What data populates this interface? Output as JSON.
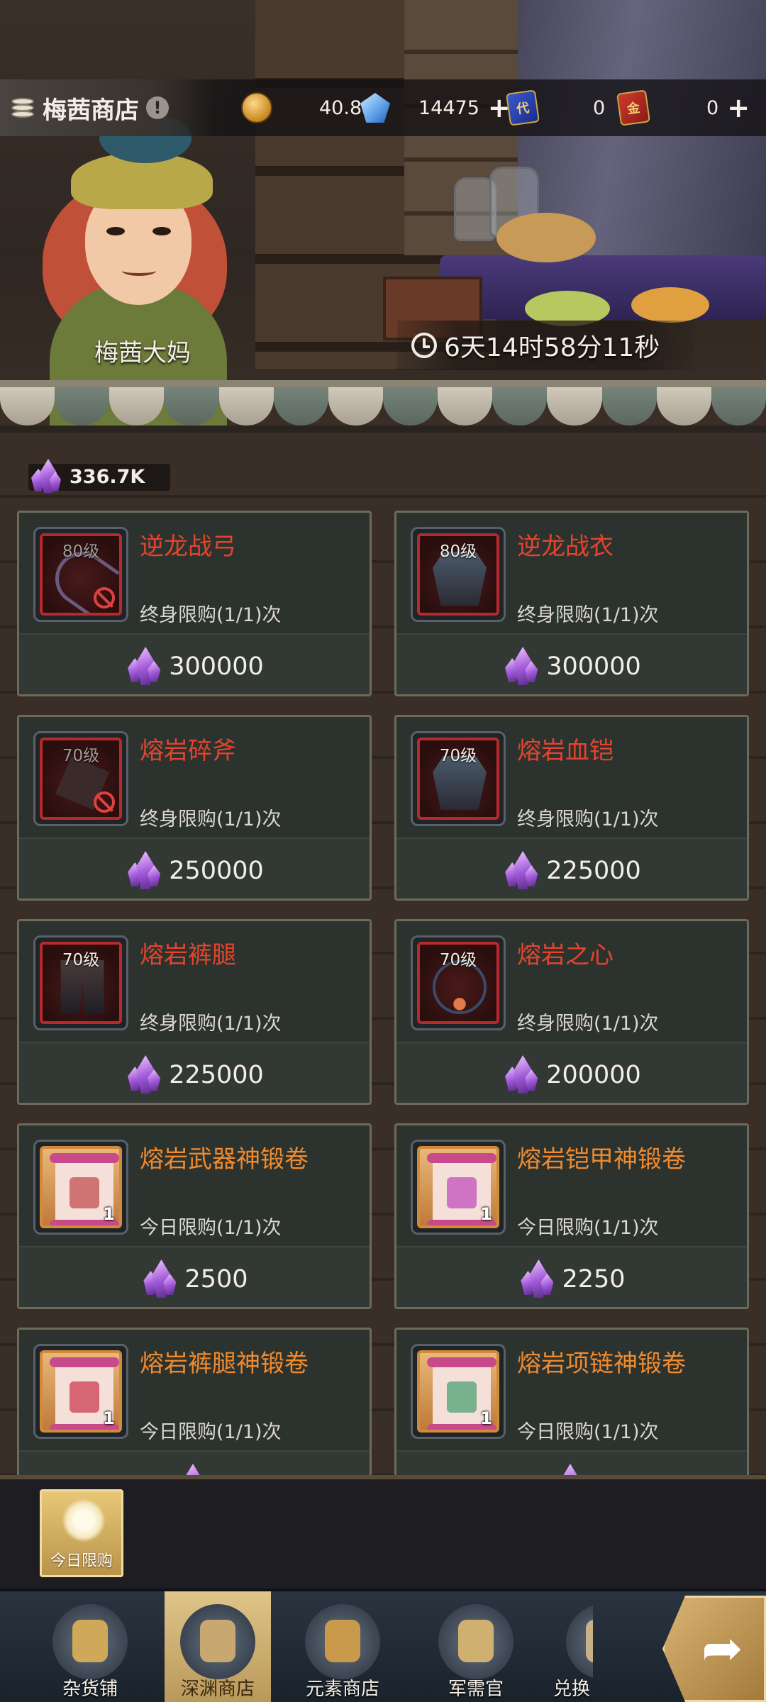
{
  "header": {
    "shop_title": "梅茜商店",
    "currencies": [
      {
        "icon": "gold-coin-icon",
        "value": "40.8M",
        "has_plus": false
      },
      {
        "icon": "blue-diamond-icon",
        "value": "14475",
        "has_plus": true,
        "plus": "+"
      },
      {
        "icon": "blue-ticket-icon",
        "glyph": "代",
        "value": "0",
        "has_plus": false
      },
      {
        "icon": "red-ticket-icon",
        "glyph": "金",
        "value": "0",
        "has_plus": true,
        "plus": "+"
      }
    ]
  },
  "npc": {
    "name": "梅茜大妈"
  },
  "timer": {
    "text": "6天14时58分11秒"
  },
  "balance": {
    "icon": "purple-crystal-icon",
    "value": "336.7K"
  },
  "items": [
    {
      "name": "逆龙战弓",
      "level": "80级",
      "limit": "终身限购(1/1)次",
      "price": "300000",
      "type": "bow",
      "style": "red",
      "locked": true
    },
    {
      "name": "逆龙战衣",
      "level": "80级",
      "limit": "终身限购(1/1)次",
      "price": "300000",
      "type": "armor",
      "style": "red",
      "locked": false
    },
    {
      "name": "熔岩碎斧",
      "level": "70级",
      "limit": "终身限购(1/1)次",
      "price": "250000",
      "type": "axe",
      "style": "red",
      "locked": true
    },
    {
      "name": "熔岩血铠",
      "level": "70级",
      "limit": "终身限购(1/1)次",
      "price": "225000",
      "type": "armor",
      "style": "red",
      "locked": false
    },
    {
      "name": "熔岩裤腿",
      "level": "70级",
      "limit": "终身限购(1/1)次",
      "price": "225000",
      "type": "legs",
      "style": "red",
      "locked": false
    },
    {
      "name": "熔岩之心",
      "level": "70级",
      "limit": "终身限购(1/1)次",
      "price": "200000",
      "type": "necklace",
      "style": "red",
      "locked": false
    },
    {
      "name": "熔岩武器神锻卷",
      "qty": "1",
      "limit": "今日限购(1/1)次",
      "price": "2500",
      "type": "scroll",
      "style": "scroll",
      "emblem": "#c86060"
    },
    {
      "name": "熔岩铠甲神锻卷",
      "qty": "1",
      "limit": "今日限购(1/1)次",
      "price": "2250",
      "type": "scroll",
      "style": "scroll",
      "emblem": "#c860c0"
    },
    {
      "name": "熔岩裤腿神锻卷",
      "qty": "1",
      "limit": "今日限购(1/1)次",
      "price": "",
      "type": "scroll",
      "style": "scroll",
      "emblem": "#d05060"
    },
    {
      "name": "熔岩项链神锻卷",
      "qty": "1",
      "limit": "今日限购(1/1)次",
      "price": "",
      "type": "scroll",
      "style": "scroll",
      "emblem": "#60a880"
    }
  ],
  "promo": {
    "daily_label": "今日限购"
  },
  "nav": [
    {
      "label": "杂货铺",
      "icon": "coins-icon",
      "active": false
    },
    {
      "label": "深渊商店",
      "icon": "abyss-shop-icon",
      "active": true
    },
    {
      "label": "元素商店",
      "icon": "element-star-icon",
      "active": false
    },
    {
      "label": "军需官",
      "icon": "quartermaster-icon",
      "active": false
    },
    {
      "label": "兑换",
      "icon": "exchange-icon",
      "active": false
    }
  ],
  "colors": {
    "name_red": "#e4442e",
    "name_orange": "#f08a2e",
    "crystal": "#a058d8"
  }
}
